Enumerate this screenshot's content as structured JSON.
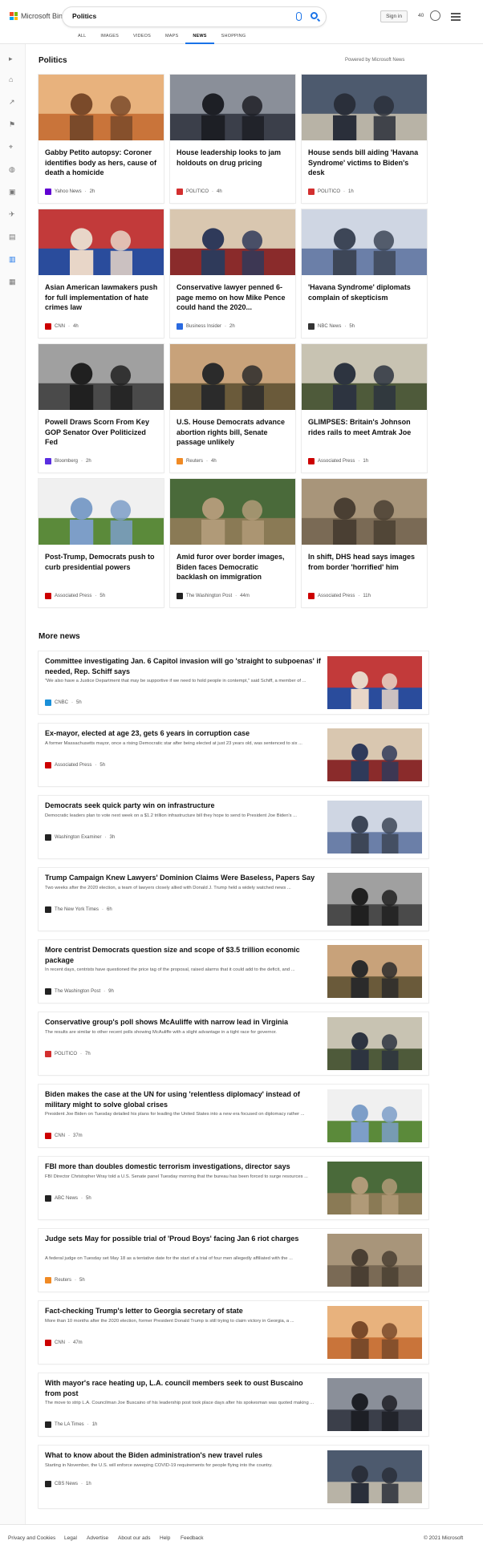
{
  "app": {
    "logo_text": "Microsoft Bing",
    "query": "Politics",
    "sign_in": "Sign in",
    "rewards_points": "40"
  },
  "tabs": [
    {
      "label": "ALL",
      "active": false
    },
    {
      "label": "IMAGES",
      "active": false
    },
    {
      "label": "VIDEOS",
      "active": false
    },
    {
      "label": "MAPS",
      "active": false
    },
    {
      "label": "NEWS",
      "active": true
    },
    {
      "label": "SHOPPING",
      "active": false
    }
  ],
  "rail_icons": [
    "expand-icon",
    "home-icon",
    "trending-icon",
    "flag-icon",
    "location-icon",
    "globe-icon",
    "business-icon",
    "science-icon",
    "entertainment-icon",
    "politics-icon",
    "education-icon"
  ],
  "section": {
    "title": "Politics",
    "powered_by": "Powered by Microsoft News"
  },
  "top_stories": [
    {
      "title": "Gabby Petito autopsy: Coroner identifies body as hers, cause of death a homicide",
      "source": "Yahoo News",
      "time": "2h",
      "logo_color": "#6001d2"
    },
    {
      "title": "House leadership looks to jam holdouts on drug pricing",
      "source": "POLITICO",
      "time": "4h",
      "logo_color": "#d32f2f"
    },
    {
      "title": "House sends bill aiding 'Havana Syndrome' victims to Biden's desk",
      "source": "POLITICO",
      "time": "1h",
      "logo_color": "#d32f2f"
    },
    {
      "title": "Asian American lawmakers push for full implementation of hate crimes law",
      "source": "CNN",
      "time": "4h",
      "logo_color": "#cc0000"
    },
    {
      "title": "Conservative lawyer penned 6-page memo on how Mike Pence could hand the 2020...",
      "source": "Business Insider",
      "time": "2h",
      "logo_color": "#2a6ae0"
    },
    {
      "title": "'Havana Syndrome' diplomats complain of skepticism",
      "source": "NBC News",
      "time": "5h",
      "logo_color": "#333333"
    },
    {
      "title": "Powell Draws Scorn From Key GOP Senator Over Politicized Fed",
      "source": "Bloomberg",
      "time": "2h",
      "logo_color": "#5a2ee0"
    },
    {
      "title": "U.S. House Democrats advance abortion rights bill, Senate passage unlikely",
      "source": "Reuters",
      "time": "4h",
      "logo_color": "#f08a24"
    },
    {
      "title": "GLIMPSES: Britain's Johnson rides rails to meet Amtrak Joe",
      "source": "Associated Press",
      "time": "1h",
      "logo_color": "#cc0000"
    },
    {
      "title": "Post-Trump, Democrats push to curb presidential powers",
      "source": "Associated Press",
      "time": "5h",
      "logo_color": "#cc0000"
    },
    {
      "title": "Amid furor over border images, Biden faces Democratic backlash on immigration",
      "source": "The Washington Post",
      "time": "44m",
      "logo_color": "#222222"
    },
    {
      "title": "In shift, DHS head says images from border 'horrified' him",
      "source": "Associated Press",
      "time": "11h",
      "logo_color": "#cc0000"
    }
  ],
  "more_news_title": "More news",
  "more_news": [
    {
      "title": "Committee investigating Jan. 6 Capitol invasion will go 'straight to subpoenas' if needed, Rep. Schiff says",
      "desc": "\"We also have a Justice Department that may be supportive if we need to hold people in contempt,\" said Schiff, a member of ...",
      "source": "CNBC",
      "time": "5h",
      "logo_color": "#1a8fd8"
    },
    {
      "title": "Ex-mayor, elected at age 23, gets 6 years in corruption case",
      "desc": "A former Massachusetts mayor, once a rising Democratic star after being elected at just 23 years old, was sentenced to six ...",
      "source": "Associated Press",
      "time": "5h",
      "logo_color": "#cc0000"
    },
    {
      "title": "Democrats seek quick party win on infrastructure",
      "desc": "Democratic leaders plan to vote next week on a $1.2 trillion infrastructure bill they hope to send to President Joe Biden's ...",
      "source": "Washington Examiner",
      "time": "3h",
      "logo_color": "#222222"
    },
    {
      "title": "Trump Campaign Knew Lawyers' Dominion Claims Were Baseless, Papers Say",
      "desc": "Two weeks after the 2020 election, a team of lawyers closely allied with Donald J. Trump held a widely watched news ...",
      "source": "The New York Times",
      "time": "6h",
      "logo_color": "#222222"
    },
    {
      "title": "More centrist Democrats question size and scope of $3.5 trillion economic package",
      "desc": "In recent days, centrists have questioned the price tag of the proposal, raised alarms that it could add to the deficit, and ...",
      "source": "The Washington Post",
      "time": "9h",
      "logo_color": "#222222"
    },
    {
      "title": "Conservative group's poll shows McAuliffe with narrow lead in Virginia",
      "desc": "The results are similar to other recent polls showing McAuliffe with a slight advantage in a tight race for governor.",
      "source": "POLITICO",
      "time": "7h",
      "logo_color": "#d32f2f"
    },
    {
      "title": "Biden makes the case at the UN for using 'relentless diplomacy' instead of military might to solve global crises",
      "desc": "President Joe Biden on Tuesday detailed his plans for leading the United States into a new era focused on diplomacy rather ...",
      "source": "CNN",
      "time": "37m",
      "logo_color": "#cc0000"
    },
    {
      "title": "FBI more than doubles domestic terrorism investigations, director says",
      "desc": "FBI Director Christopher Wray told a U.S. Senate panel Tuesday morning that the bureau has been forced to surge resources ...",
      "source": "ABC News",
      "time": "5h",
      "logo_color": "#222222"
    },
    {
      "title": "Judge sets May for possible trial of 'Proud Boys' facing Jan 6 riot charges",
      "desc": "A federal judge on Tuesday set May 18 as a tentative date for the start of a trial of four men allegedly affiliated with the ...",
      "source": "Reuters",
      "time": "5h",
      "logo_color": "#f08a24"
    },
    {
      "title": "Fact-checking Trump's letter to Georgia secretary of state",
      "desc": "More than 10 months after the 2020 election, former President Donald Trump is still trying to claim victory in Georgia, a ...",
      "source": "CNN",
      "time": "47m",
      "logo_color": "#cc0000"
    },
    {
      "title": "With mayor's race heating up, L.A. council members seek to oust Buscaino from post",
      "desc": "The move to strip L.A. Councilman Joe Buscaino of his leadership post took place days after his spokesman was quoted making ...",
      "source": "The LA Times",
      "time": "1h",
      "logo_color": "#222222"
    },
    {
      "title": "What to know about the Biden administration's new travel rules",
      "desc": "Starting in November, the U.S. will enforce sweeping COVID-19 requirements for people flying into the country.",
      "source": "CBS News",
      "time": "1h",
      "logo_color": "#222222"
    }
  ],
  "footer": {
    "links": [
      "Privacy and Cookies",
      "Legal",
      "Advertise",
      "About our ads",
      "Help",
      "Feedback"
    ],
    "copyright": "© 2021 Microsoft"
  }
}
